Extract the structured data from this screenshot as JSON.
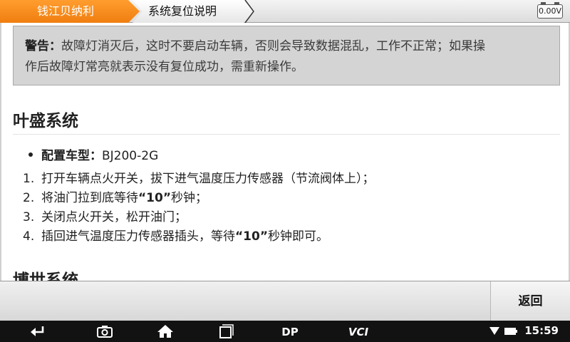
{
  "breadcrumb": {
    "brand": "钱江贝纳利",
    "page": "系统复位说明"
  },
  "voltage": "0.00V",
  "warning": {
    "label": "警告：",
    "text_line1": "故障灯消灭后，这时不要启动车辆，否则会导致数据混乱，工作不正常；如果操",
    "text_line2": "作后故障灯常亮就表示没有复位成功，需重新操作。"
  },
  "section": {
    "title": "叶盛系统",
    "model_label": "配置车型：",
    "model_value": "BJ200-2G",
    "steps": [
      {
        "num": "1.",
        "pre": "打开车辆点火开关，拔下进气温度压力传感器（节流阀体上）；",
        "bold": "",
        "post": ""
      },
      {
        "num": "2.",
        "pre": "将油门拉到底等待",
        "bold": "“10”",
        "post": "秒钟；"
      },
      {
        "num": "3.",
        "pre": "关闭点火开关，松开油门；",
        "bold": "",
        "post": ""
      },
      {
        "num": "4.",
        "pre": "插回进气温度压力传感器插头，等待",
        "bold": "“10”",
        "post": "秒钟即可。"
      }
    ]
  },
  "next_section_title": "博世系统",
  "actions": {
    "back_label": "返回"
  },
  "status": {
    "time": "15:59",
    "nav_labels": [
      "DP",
      "VCI"
    ]
  },
  "colors": {
    "brand_orange": "#f07e10",
    "warning_bg": "#d4d4d4"
  }
}
